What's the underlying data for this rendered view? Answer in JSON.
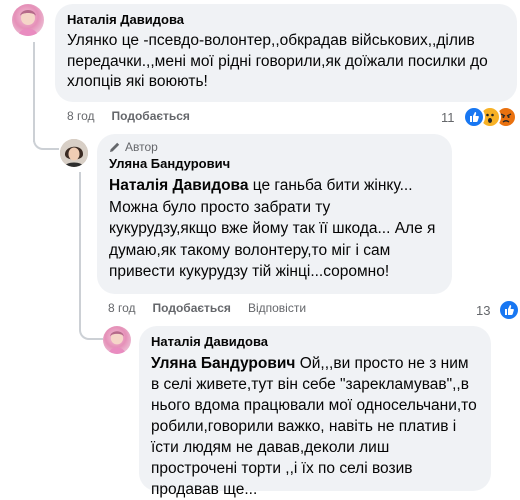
{
  "comment1": {
    "author": "Наталія Давидова",
    "text": "Улянко це -псевдо-волонтер,,обкрадав військових,,ділив передачки.,,мені мої рідні говорили,як доїжали посилки до хлопців які воюють!",
    "time": "8 год",
    "like_label": "Подобається",
    "reactions_count": "11"
  },
  "comment2": {
    "badge": "Автор",
    "author": "Уляна Бандурович",
    "mention": "Наталія Давидова",
    "text_after_mention": " це ганьба бити жінку... Можна було просто забрати ту кукурудзу,якщо вже йому так її шкода... Але я думаю,як такому волонтеру,то міг і сам привести кукурудзу тій жінці...соромно!",
    "time": "8 год",
    "like_label": "Подобається",
    "reply_label": "Відповісти",
    "reactions_count": "13"
  },
  "comment3": {
    "author": "Наталія Давидова",
    "mention": "Уляна Бандурович",
    "text_after_mention": " Ой,,,ви просто не з ним в селі живете,тут він себе \"зарекламував\",,в нього вдома працювали мої односельчани,то робили,говорили важко, навіть не платив і їсти людям не давав,деколи лиш прострочені торти ,,і їх по селі возив продавав ще..."
  },
  "colors": {
    "bubble": "#f0f2f5",
    "meta": "#65676b",
    "like_blue": "#1877f2",
    "haha_yellow": "#f7b125",
    "angry_red": "#e9710f"
  },
  "icons": [
    "pencil-icon",
    "like-reaction-icon",
    "wow-reaction-icon",
    "angry-reaction-icon"
  ]
}
